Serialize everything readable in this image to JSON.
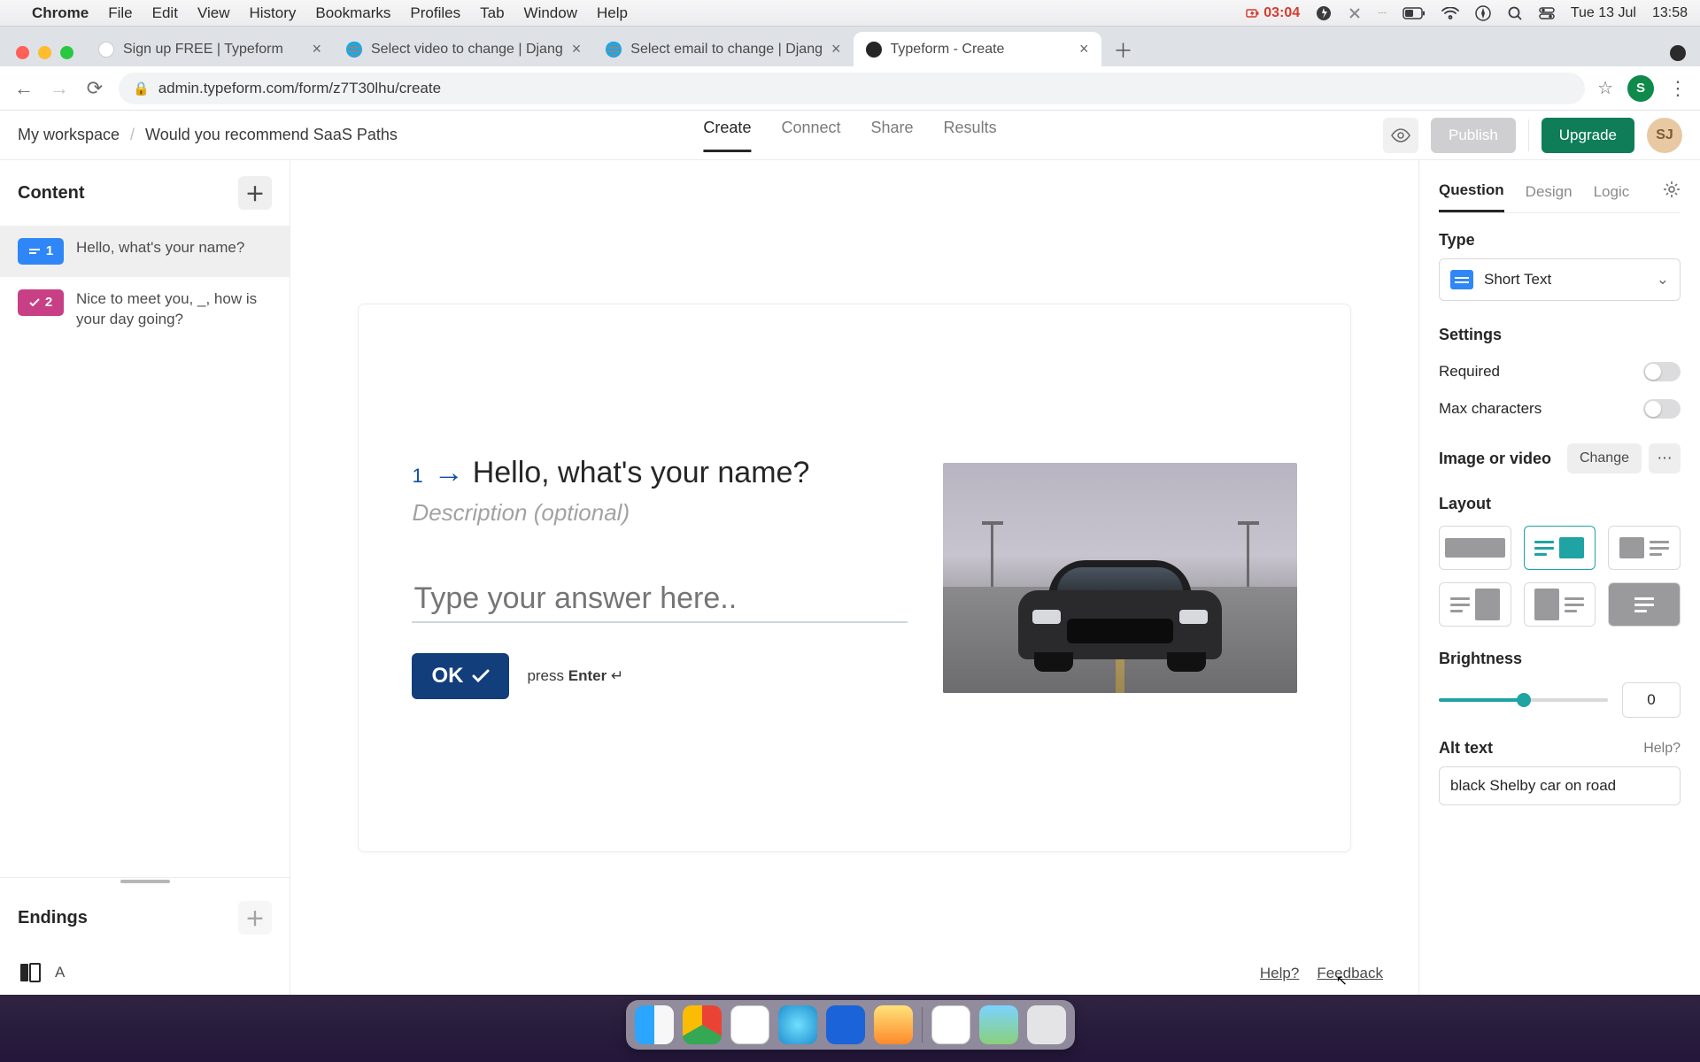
{
  "menubar": {
    "app": "Chrome",
    "items": [
      "File",
      "Edit",
      "View",
      "History",
      "Bookmarks",
      "Profiles",
      "Tab",
      "Window",
      "Help"
    ],
    "battery_time": "03:04",
    "date": "Tue 13 Jul",
    "clock": "13:58"
  },
  "tabs": [
    {
      "title": "Sign up FREE | Typeform",
      "active": false
    },
    {
      "title": "Select video to change | Djang",
      "active": false
    },
    {
      "title": "Select email to change | Djang",
      "active": false
    },
    {
      "title": "Typeform - Create",
      "active": true
    }
  ],
  "address": "admin.typeform.com/form/z7T30lhu/create",
  "avatar_letter": "S",
  "breadcrumb": {
    "workspace": "My workspace",
    "form": "Would you recommend SaaS Paths"
  },
  "center_tabs": [
    "Create",
    "Connect",
    "Share",
    "Results"
  ],
  "top_buttons": {
    "publish": "Publish",
    "upgrade": "Upgrade",
    "avatar": "SJ"
  },
  "left": {
    "content_label": "Content",
    "questions": [
      {
        "num": "1",
        "text": "Hello, what's your name?",
        "color": "blue"
      },
      {
        "num": "2",
        "text": "Nice to meet you, _, how is your day going?",
        "color": "pink"
      }
    ],
    "endings_label": "Endings",
    "ending_letter": "A"
  },
  "canvas": {
    "q_number": "1",
    "title": "Hello, what's your name?",
    "description": "Description (optional)",
    "answer_placeholder": "Type your answer here..",
    "ok": "OK",
    "press": "press ",
    "enter": "Enter",
    "help": "Help?",
    "feedback": "Feedback"
  },
  "right": {
    "tabs": [
      "Question",
      "Design",
      "Logic"
    ],
    "type_label": "Type",
    "type_value": "Short Text",
    "settings_label": "Settings",
    "required": "Required",
    "maxchars": "Max characters",
    "imgvid": "Image or video",
    "change": "Change",
    "layout": "Layout",
    "brightness": "Brightness",
    "brightness_value": "0",
    "alt_label": "Alt text",
    "alt_help": "Help?",
    "alt_value": "black Shelby car on road"
  }
}
